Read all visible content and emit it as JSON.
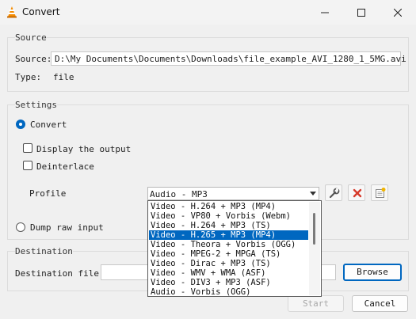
{
  "window": {
    "title": "Convert",
    "controls": {
      "minimize": "minimize-icon",
      "maximize": "maximize-icon",
      "close": "close-icon"
    }
  },
  "source": {
    "group_title": "Source",
    "source_label": "Source:",
    "source_value": "D:\\My Documents\\Documents\\Downloads\\file_example_AVI_1280_1_5MG.avi",
    "type_label": "Type:",
    "type_value": "file"
  },
  "settings": {
    "group_title": "Settings",
    "convert_label": "Convert",
    "convert_selected": true,
    "display_output_label": "Display the output",
    "display_output_checked": false,
    "deinterlace_label": "Deinterlace",
    "deinterlace_checked": false,
    "profile_label": "Profile",
    "profile_selected": "Audio - MP3",
    "dump_raw_label": "Dump raw input",
    "dump_raw_selected": false,
    "profile_tools": [
      "wrench-icon",
      "delete-x-icon",
      "new-profile-icon"
    ]
  },
  "profile_dropdown": {
    "items": [
      "Video - H.264 + MP3 (MP4)",
      "Video - VP80 + Vorbis (Webm)",
      "Video - H.264 + MP3 (TS)",
      "Video - H.265 + MP3 (MP4)",
      "Video - Theora + Vorbis (OGG)",
      "Video - MPEG-2 + MPGA (TS)",
      "Video - Dirac + MP3 (TS)",
      "Video - WMV + WMA (ASF)",
      "Video - DIV3 + MP3 (ASF)",
      "Audio - Vorbis (OGG)"
    ],
    "selected": "Video - H.265 + MP3 (MP4)"
  },
  "destination": {
    "group_title": "Destination",
    "file_label": "Destination file:",
    "file_value": "",
    "browse_label": "Browse"
  },
  "footer": {
    "start_label": "Start",
    "cancel_label": "Cancel"
  },
  "colors": {
    "accent": "#0067c0",
    "window_bg": "#f0f0f0",
    "delete_red": "#d63a2a"
  }
}
